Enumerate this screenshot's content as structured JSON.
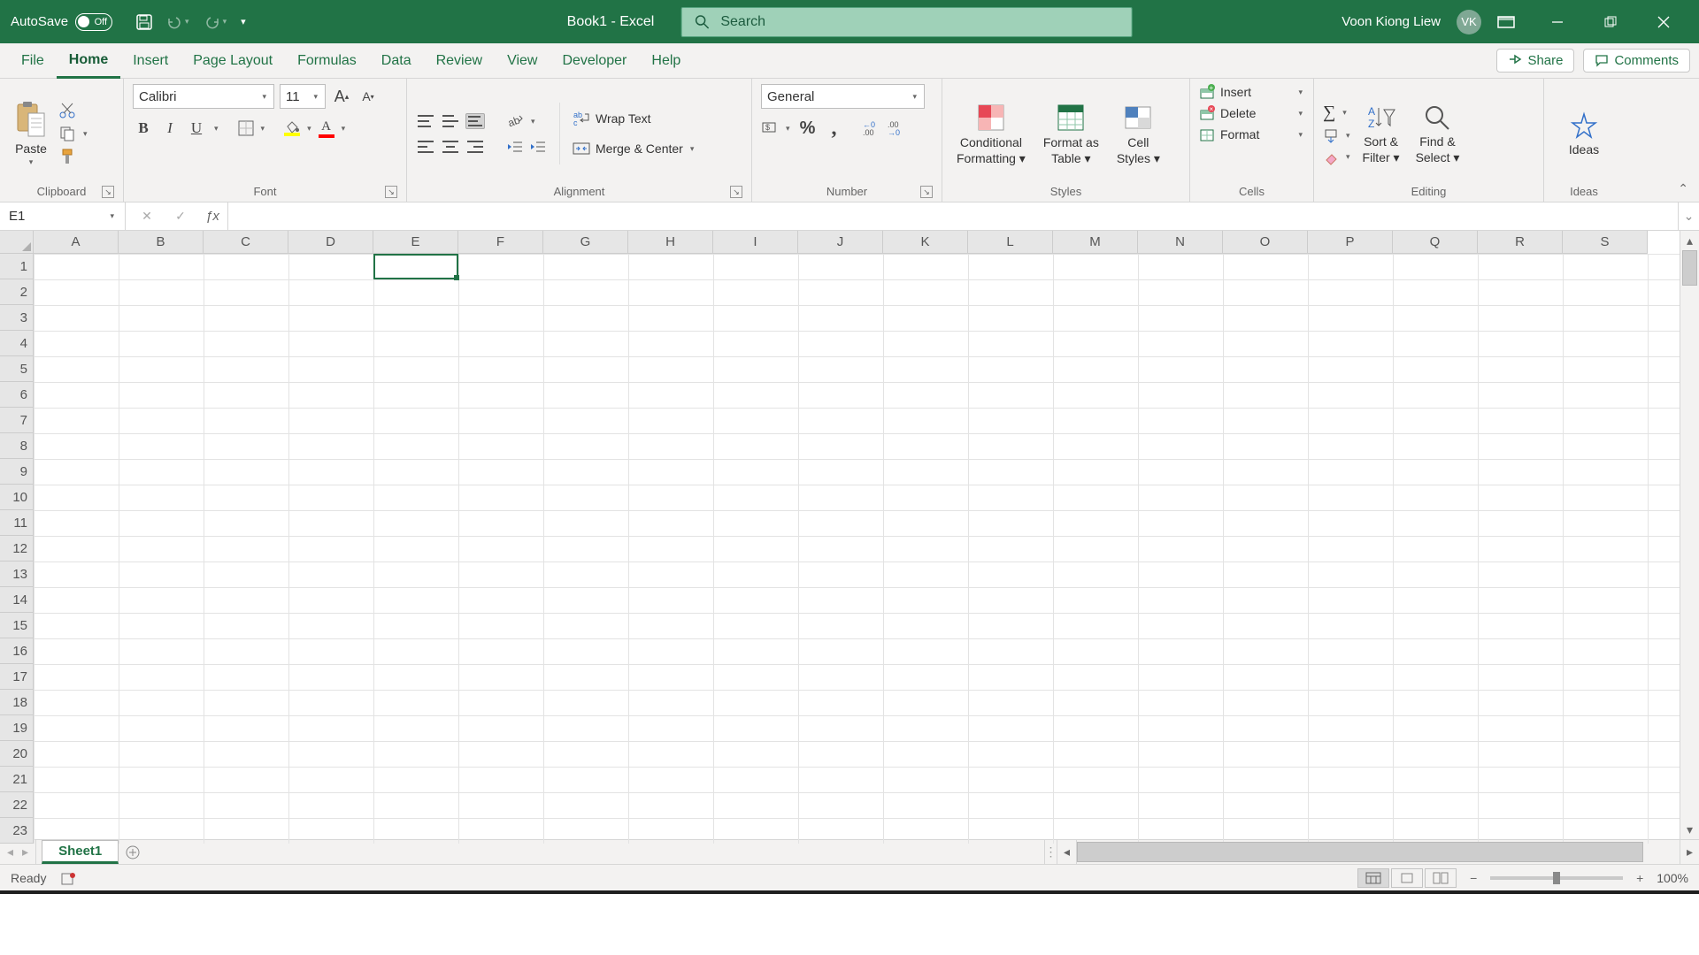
{
  "titlebar": {
    "autosave_label": "AutoSave",
    "autosave_state": "Off",
    "doc_title": "Book1  -  Excel",
    "search_placeholder": "Search",
    "user_name": "Voon Kiong Liew",
    "user_initials": "VK"
  },
  "tabs": [
    "File",
    "Home",
    "Insert",
    "Page Layout",
    "Formulas",
    "Data",
    "Review",
    "View",
    "Developer",
    "Help"
  ],
  "active_tab_index": 1,
  "share_label": "Share",
  "comments_label": "Comments",
  "ribbon": {
    "clipboard": {
      "paste": "Paste",
      "label": "Clipboard"
    },
    "font": {
      "name": "Calibri",
      "size": "11",
      "label": "Font",
      "bold": "B",
      "italic": "I",
      "underline": "U",
      "grow": "A",
      "shrink": "A"
    },
    "alignment": {
      "wrap": "Wrap Text",
      "merge": "Merge & Center",
      "label": "Alignment"
    },
    "number": {
      "format": "General",
      "percent": "%",
      "comma": ",",
      "label": "Number"
    },
    "styles": {
      "cond": "Conditional Formatting",
      "table": "Format as Table",
      "cell": "Cell Styles",
      "label": "Styles"
    },
    "cells": {
      "insert": "Insert",
      "delete": "Delete",
      "format": "Format",
      "label": "Cells"
    },
    "editing": {
      "sort": "Sort & Filter",
      "find": "Find & Select",
      "label": "Editing"
    },
    "ideas": {
      "label": "Ideas",
      "button": "Ideas"
    }
  },
  "name_box": "E1",
  "formula_value": "",
  "columns": [
    "A",
    "B",
    "C",
    "D",
    "E",
    "F",
    "G",
    "H",
    "I",
    "J",
    "K",
    "L",
    "M",
    "N",
    "O",
    "P",
    "Q",
    "R",
    "S"
  ],
  "rows": [
    "1",
    "2",
    "3",
    "4",
    "5",
    "6",
    "7",
    "8",
    "9",
    "10",
    "11",
    "12",
    "13",
    "14",
    "15",
    "16",
    "17",
    "18",
    "19",
    "20",
    "21",
    "22",
    "23"
  ],
  "selected_cell": {
    "col_index": 4,
    "row_index": 0
  },
  "sheet_name": "Sheet1",
  "status": {
    "ready": "Ready",
    "zoom": "100%"
  }
}
